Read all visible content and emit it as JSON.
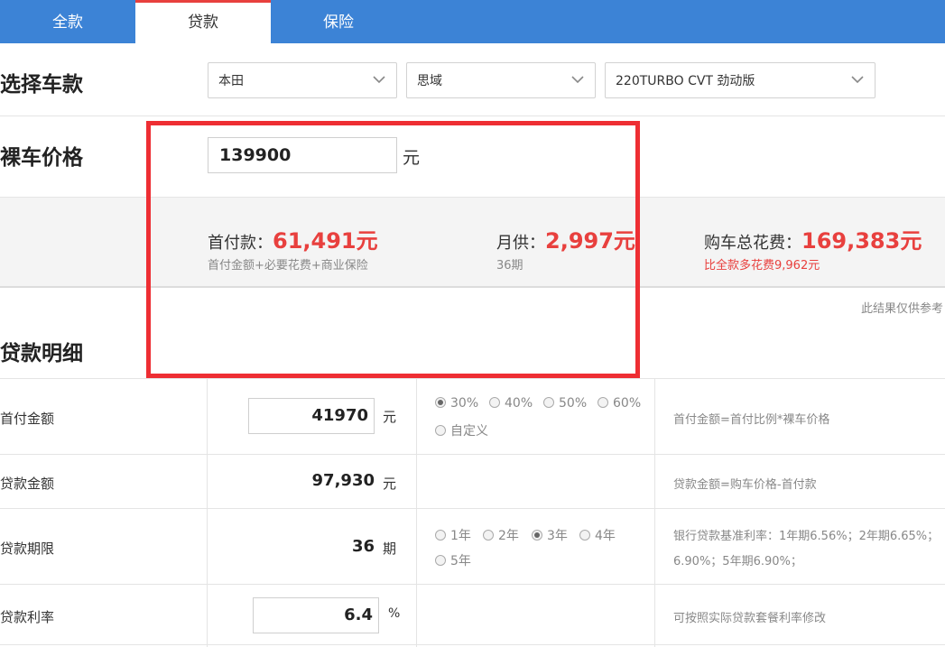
{
  "tabs": [
    {
      "label": "全款"
    },
    {
      "label": "贷款"
    },
    {
      "label": "保险"
    }
  ],
  "select_car": {
    "title": "选择车款",
    "brand": "本田",
    "series": "思域",
    "model": "220TURBO CVT 劲动版"
  },
  "price": {
    "title": "裸车价格",
    "value": "139900",
    "unit": "元"
  },
  "summary": {
    "down_payment": {
      "label": "首付款：",
      "value": "61,491元",
      "sub": "首付金额+必要花费+商业保险"
    },
    "monthly": {
      "label": "月供：",
      "value": "2,997元",
      "sub": "36期"
    },
    "total": {
      "label": "购车总花费：",
      "value": "169,383元",
      "sub": "比全款多花费9,962元"
    }
  },
  "note": "此结果仅供参考",
  "details": {
    "title": "贷款明细",
    "down": {
      "label": "首付金额",
      "value": "41970",
      "unit": "元",
      "options": [
        "30%",
        "40%",
        "50%",
        "60%",
        "自定义"
      ],
      "selected": "30%",
      "hint": "首付金额=首付比例*裸车价格"
    },
    "loan": {
      "label": "贷款金额",
      "value": "97,930",
      "unit": "元",
      "hint": "贷款金额=购车价格-首付款"
    },
    "term": {
      "label": "贷款期限",
      "value": "36",
      "unit": "期",
      "options": [
        "1年",
        "2年",
        "3年",
        "4年",
        "5年"
      ],
      "selected": "3年",
      "hint_line1": "银行贷款基准利率：1年期6.56%；2年期6.65%；",
      "hint_line2": "6.90%；5年期6.90%；"
    },
    "rate": {
      "label": "贷款利率",
      "value": "6.4",
      "unit": "%",
      "hint": "可按照实际贷款套餐利率修改"
    }
  },
  "colors": {
    "tab_bar": "#3c83d6",
    "accent_red": "#e8403e",
    "highlight_box": "#ee2e33"
  }
}
